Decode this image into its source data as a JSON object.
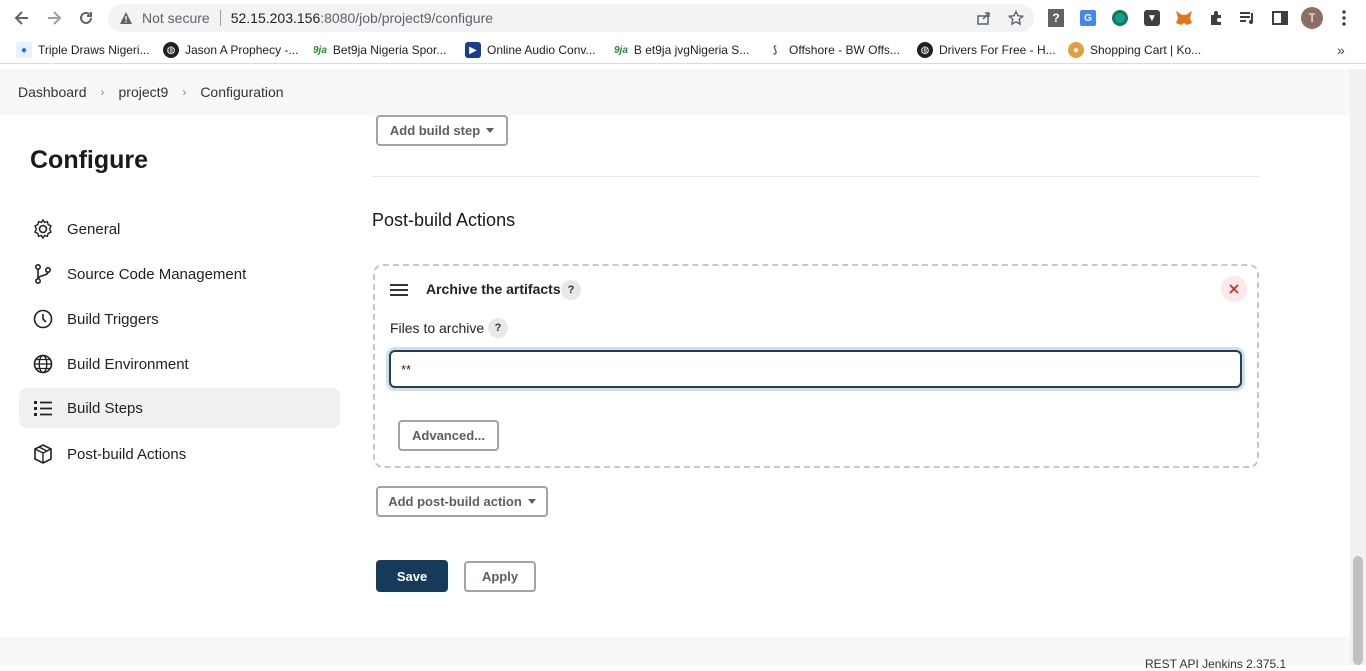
{
  "browser": {
    "security_text": "Not secure",
    "url_host": "52.15.203.156",
    "url_path": ":8080/job/project9/configure",
    "profile_initial": "T",
    "bookmarks": [
      {
        "label": "Triple Draws Nigeri...",
        "icon": "globe-icon"
      },
      {
        "label": "Jason A Prophecy -...",
        "icon": "globe-icon"
      },
      {
        "label": "Bet9ja Nigeria Spor...",
        "icon": "bet9ja-icon"
      },
      {
        "label": "Online Audio Conv...",
        "icon": "play-icon"
      },
      {
        "label": "B et9ja jvgNigeria S...",
        "icon": "bet9ja-icon"
      },
      {
        "label": "Offshore - BW Offs...",
        "icon": "bw-icon"
      },
      {
        "label": "Drivers For Free - H...",
        "icon": "globe-icon"
      },
      {
        "label": "Shopping Cart | Ko...",
        "icon": "cart-icon"
      }
    ]
  },
  "breadcrumb": {
    "items": [
      "Dashboard",
      "project9",
      "Configuration"
    ]
  },
  "page": {
    "title": "Configure"
  },
  "sidebar": {
    "items": [
      {
        "label": "General",
        "icon": "gear-icon",
        "active": false
      },
      {
        "label": "Source Code Management",
        "icon": "branch-icon",
        "active": false
      },
      {
        "label": "Build Triggers",
        "icon": "clock-icon",
        "active": false
      },
      {
        "label": "Build Environment",
        "icon": "globe-icon",
        "active": false
      },
      {
        "label": "Build Steps",
        "icon": "list-icon",
        "active": true
      },
      {
        "label": "Post-build Actions",
        "icon": "package-icon",
        "active": false
      }
    ]
  },
  "main": {
    "add_build_step_label": "Add build step",
    "post_build_title": "Post-build Actions",
    "artifact_card": {
      "title": "Archive the artifacts",
      "help": "?",
      "files_label": "Files to archive",
      "files_value": "**",
      "advanced_label": "Advanced..."
    },
    "add_post_build_label": "Add post-build action",
    "save_label": "Save",
    "apply_label": "Apply"
  },
  "footer": {
    "text": "REST API      Jenkins 2.375.1"
  },
  "colors": {
    "primary": "#163a5a",
    "focus_border": "#253e59",
    "close_bg": "#fde7e9",
    "close_fg": "#c62828"
  }
}
